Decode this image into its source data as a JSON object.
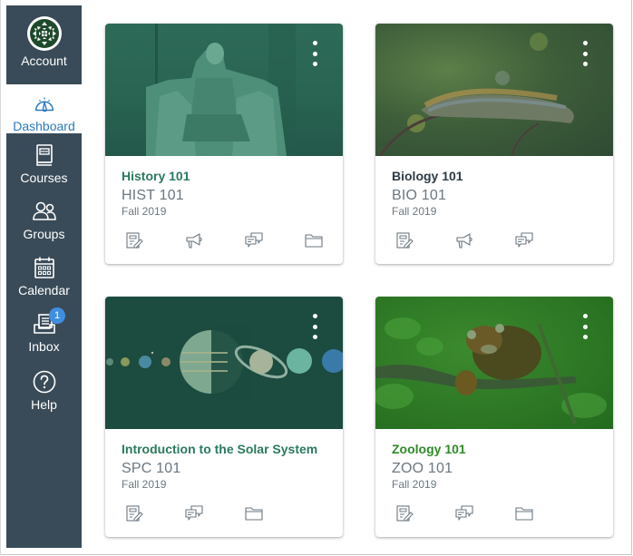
{
  "nav": {
    "items": [
      {
        "id": "account",
        "label": "Account",
        "icon": "account-avatar",
        "active": false
      },
      {
        "id": "dashboard",
        "label": "Dashboard",
        "icon": "dashboard-icon",
        "active": true
      },
      {
        "id": "courses",
        "label": "Courses",
        "icon": "courses-icon",
        "active": false
      },
      {
        "id": "groups",
        "label": "Groups",
        "icon": "groups-icon",
        "active": false
      },
      {
        "id": "calendar",
        "label": "Calendar",
        "icon": "calendar-icon",
        "active": false
      },
      {
        "id": "inbox",
        "label": "Inbox",
        "icon": "inbox-icon",
        "active": false,
        "badge": "1"
      },
      {
        "id": "help",
        "label": "Help",
        "icon": "help-icon",
        "active": false
      }
    ],
    "colors": {
      "background": "#394b58",
      "active_text": "#2b7abc",
      "badge": "#3f8fe0"
    }
  },
  "cards": [
    {
      "title": "History 101",
      "code": "HIST 101",
      "term": "Fall 2019",
      "title_color": "#2a7a5c",
      "image": "Lincoln Memorial statue",
      "actions": [
        "assignments",
        "announcements",
        "discussions",
        "files"
      ]
    },
    {
      "title": "Biology 101",
      "code": "BIO 101",
      "term": "Fall 2019",
      "title_color": "#2d3b45",
      "image": "Caterpillar on stem",
      "actions": [
        "assignments",
        "announcements",
        "discussions"
      ]
    },
    {
      "title": "Introduction to the Solar System",
      "code": "SPC 101",
      "term": "Fall 2019",
      "title_color": "#2a7a5c",
      "image": "Planets of the solar system",
      "actions": [
        "assignments",
        "discussions",
        "files"
      ]
    },
    {
      "title": "Zoology 101",
      "code": "ZOO 101",
      "term": "Fall 2019",
      "title_color": "#2e8a26",
      "image": "Red panda on branch",
      "actions": [
        "assignments",
        "discussions",
        "files"
      ]
    }
  ]
}
